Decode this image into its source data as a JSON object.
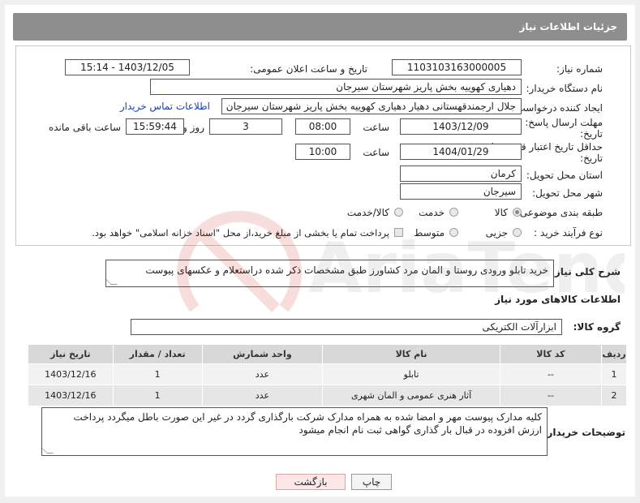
{
  "header": {
    "title": "جزئیات اطلاعات نیاز"
  },
  "form": {
    "need_number_label": "شماره نیاز:",
    "need_number": "1103103163000005",
    "announce_label": "تاریخ و ساعت اعلان عمومی:",
    "announce_value": "1403/12/05 - 15:14",
    "buyer_org_label": "نام دستگاه خریدار:",
    "buyer_org": "دهیاری کهوییه بخش پاریز شهرستان سیرجان",
    "requester_label": "ایجاد کننده درخواست:",
    "requester": "جلال ارجمندقهستانی دهیار دهیاری کهوییه بخش پاریز شهرستان سیرجان",
    "contact_link": "اطلاعات تماس خریدار",
    "reply_deadline_label_1": "مهلت ارسال پاسخ: تا",
    "reply_deadline_label_2": "تاریخ:",
    "reply_date": "1403/12/09",
    "time_label": "ساعت",
    "reply_time": "08:00",
    "days_value": "3",
    "days_label": "روز و",
    "remaining_time": "15:59:44",
    "remaining_label": "ساعت باقی مانده",
    "validity_label_1": "حداقل تاریخ اعتبار قیمت: تا",
    "validity_label_2": "تاریخ:",
    "validity_date": "1404/01/29",
    "validity_time": "10:00",
    "province_label": "استان محل تحویل:",
    "province": "کرمان",
    "city_label": "شهر محل تحویل:",
    "city": "سیرجان",
    "category_label": "طبقه بندی موضوعی:",
    "category_options": [
      "کالا",
      "خدمت",
      "کالا/خدمت"
    ],
    "purchase_type_label": "نوع فرآیند خرید :",
    "purchase_options": [
      "جزیی",
      "متوسط"
    ],
    "payment_note": "پرداخت تمام یا بخشی از مبلغ خرید،از محل \"اسناد خزانه اسلامی\" خواهد بود.",
    "general_desc_label": "شرح کلی نیاز:",
    "general_desc": "خرید تابلو ورودی روستا و المان مرد کشاورز طبق مشخصات ذکر شده  دراستعلام  و عکسهای پیوست",
    "goods_info_title": "اطلاعات کالاهای مورد نیاز",
    "goods_group_label": "گروه کالا:",
    "goods_group": "ابزارآلات الکتریکی"
  },
  "table": {
    "headers": [
      "ردیف",
      "کد کالا",
      "نام کالا",
      "واحد شمارش",
      "تعداد / مقدار",
      "تاریخ نیاز"
    ],
    "rows": [
      [
        "1",
        "--",
        "تابلو",
        "عدد",
        "1",
        "1403/12/16"
      ],
      [
        "2",
        "--",
        "آثار هنری عمومی و المان شهری",
        "عدد",
        "1",
        "1403/12/16"
      ]
    ]
  },
  "buyer_notes": {
    "label": "توضیحات خریدار:",
    "text": "کلیه مدارک پیوست مهر و امضا شده به همراه مدارک شرکت بارگذاری گردد در غیر این صورت باطل میگردد پرداخت ارزش افزوده در قبال بار گذاری گواهی ثبت نام انجام میشود"
  },
  "buttons": {
    "print": "چاپ",
    "back": "بازگشت"
  },
  "watermark": {
    "text": "AriaTender.net"
  }
}
